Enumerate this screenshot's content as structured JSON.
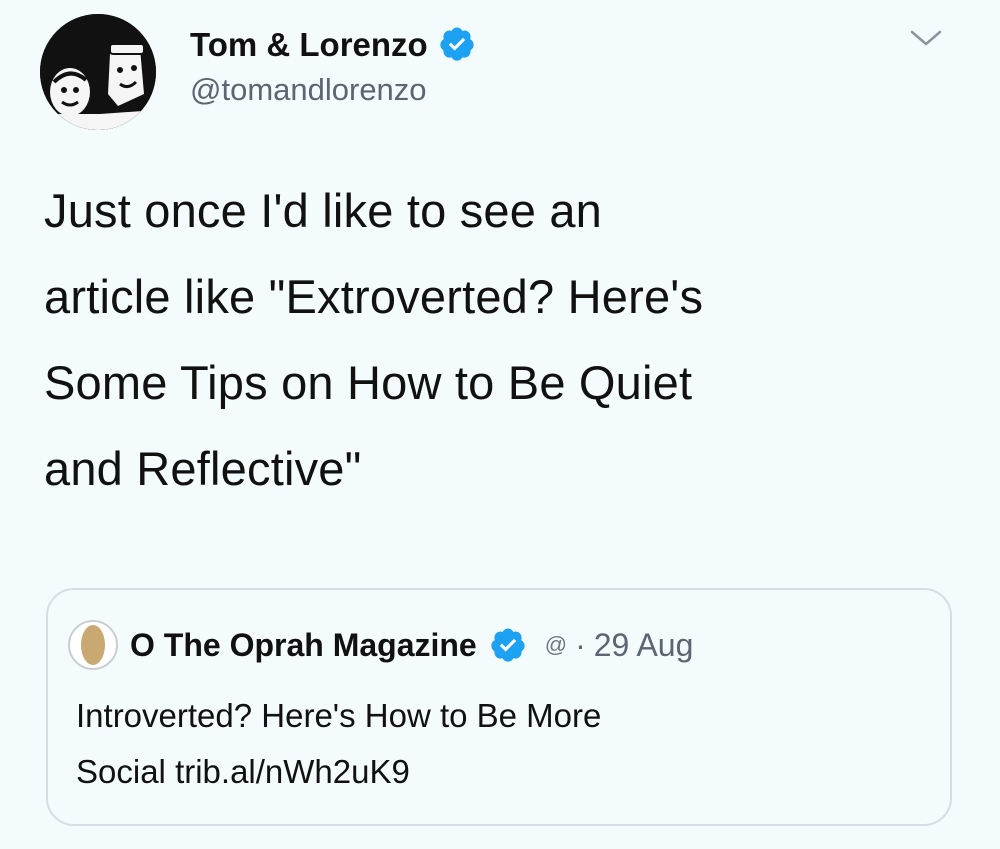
{
  "tweet": {
    "author_name": "Tom & Lorenzo",
    "author_handle": "@tomandlorenzo",
    "verified_icon": "verified-badge-icon",
    "menu_icon": "chevron-down-icon",
    "text_lines": [
      "Just once I'd like to see an",
      "article like \"Extroverted? Here's",
      "Some Tips on How to Be Quiet",
      "and Reflective\""
    ]
  },
  "quoted_tweet": {
    "author_name": "O The Oprah Magazine",
    "handle_glyph": "@",
    "separator": "·",
    "date": "29 Aug",
    "text_line1": "Introverted? Here's How to Be More",
    "text_line2_prefix": "Social",
    "link": "trib.al/nWh2uK9"
  },
  "colors": {
    "background": "#f3fbfc",
    "verified_blue": "#1da1f2",
    "secondary_text": "#5b6670",
    "card_border": "#d6dee3"
  }
}
